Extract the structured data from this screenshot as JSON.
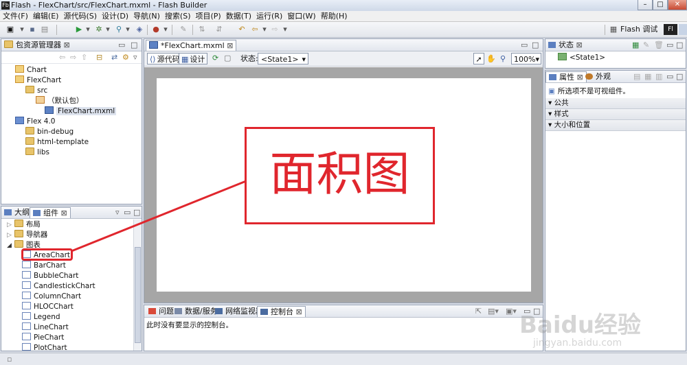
{
  "window": {
    "title": "Flash - FlexChart/src/FlexChart.mxml - Flash Builder",
    "app_badge": "Fb"
  },
  "menu": [
    "文件(F)",
    "编辑(E)",
    "源代码(S)",
    "设计(D)",
    "导航(N)",
    "搜索(S)",
    "项目(P)",
    "数据(T)",
    "运行(R)",
    "窗口(W)",
    "帮助(H)"
  ],
  "perspective": {
    "label": "Flash 调试",
    "badge": "Fl"
  },
  "package_explorer": {
    "title": "包资源管理器",
    "items": [
      {
        "label": "Chart",
        "kind": "project",
        "indent": 0
      },
      {
        "label": "FlexChart",
        "kind": "project",
        "indent": 0
      },
      {
        "label": "src",
        "kind": "folder",
        "indent": 1
      },
      {
        "label": "（默认包）",
        "kind": "package",
        "indent": 2
      },
      {
        "label": "FlexChart.mxml",
        "kind": "file",
        "indent": 3
      },
      {
        "label": "Flex 4.0",
        "kind": "library",
        "indent": 1
      },
      {
        "label": "bin-debug",
        "kind": "folder",
        "indent": 1
      },
      {
        "label": "html-template",
        "kind": "folder",
        "indent": 1
      },
      {
        "label": "libs",
        "kind": "folder",
        "indent": 1
      }
    ]
  },
  "components_panel": {
    "tabs": [
      "大纲",
      "组件"
    ],
    "folders": [
      "布局",
      "导航器",
      "图表"
    ],
    "items": [
      "AreaChart",
      "BarChart",
      "BubbleChart",
      "CandlestickChart",
      "ColumnChart",
      "HLOCChart",
      "Legend",
      "LineChart",
      "PieChart",
      "PlotChart"
    ]
  },
  "editor": {
    "tab_label": "*FlexChart.mxml",
    "source_label": "源代码",
    "design_label": "设计",
    "state_label": "状态:",
    "state_value": "<State1>",
    "zoom": "100%"
  },
  "annotation": {
    "text": "面积图"
  },
  "bottom_panel": {
    "tabs": [
      "问题",
      "数据/服务",
      "网络监视器",
      "控制台"
    ],
    "message": "此时没有要显示的控制台。"
  },
  "states_panel": {
    "title": "状态",
    "items": [
      "<State1>"
    ]
  },
  "properties_panel": {
    "tabs": [
      "属性",
      "外观"
    ],
    "message": "所选项不是可视组件。",
    "sections": [
      "公共",
      "样式",
      "大小和位置"
    ]
  },
  "watermark": {
    "text": "Baidu经验",
    "subtext": "jingyan.baidu.com"
  }
}
